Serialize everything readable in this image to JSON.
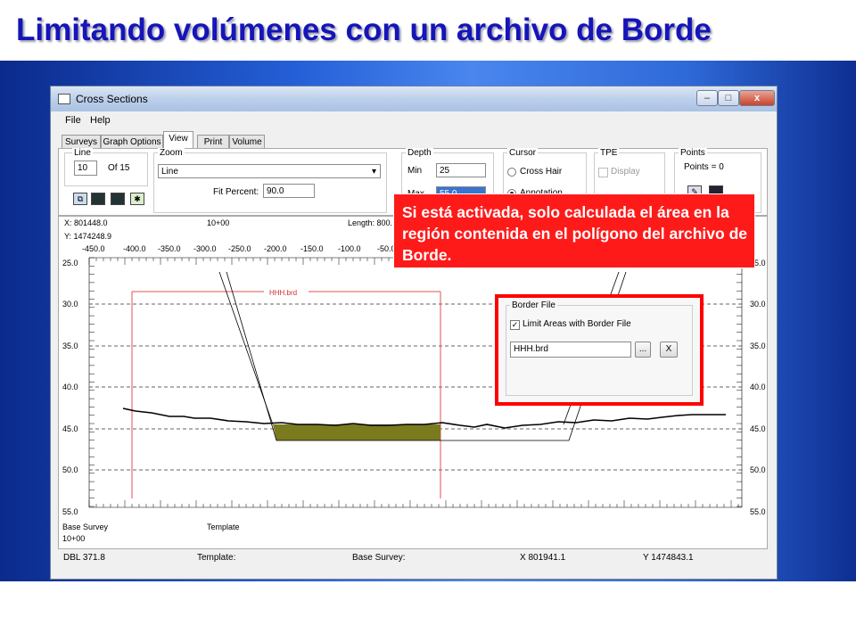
{
  "slide": {
    "title": "Limitando volúmenes con un archivo de Borde",
    "callout_text": "Si está activada, solo calculada el área en la región contenida en el polígono del archivo de Borde."
  },
  "window": {
    "title": "Cross Sections",
    "buttons": {
      "minimize": "–",
      "maximize": "□",
      "close": "x"
    },
    "menu": [
      "File",
      "Help"
    ],
    "tabs": [
      "Surveys",
      "Graph Options",
      "View",
      "Print",
      "Volume"
    ],
    "active_tab": "View"
  },
  "view_panel": {
    "line": {
      "label": "Line",
      "value": "10",
      "of_label": "Of 15"
    },
    "zoom": {
      "label": "Zoom",
      "selected": "Line",
      "fit_percent_label": "Fit Percent:",
      "fit_percent": "90.0"
    },
    "depth": {
      "label": "Depth",
      "min_label": "Min",
      "min": "25",
      "max_label": "Max",
      "max": "55.0"
    },
    "cursor": {
      "label": "Cursor",
      "options": [
        "Cross Hair",
        "Annotation"
      ],
      "selected": "Annotation"
    },
    "tpe": {
      "label": "TPE",
      "display_label": "Display",
      "checked": false
    },
    "points": {
      "label": "Points",
      "count_text": "Points = 0"
    }
  },
  "plot": {
    "x_readout": "X: 801448.0",
    "y_readout": "Y: 1474248.9",
    "station": "10+00",
    "length": "Length: 800.",
    "x_ticks": [
      "-450.0",
      "-400.0",
      "-350.0",
      "-300.0",
      "-250.0",
      "-200.0",
      "-150.0",
      "-100.0",
      "-50.0"
    ],
    "y_ticks": [
      "25.0",
      "30.0",
      "35.0",
      "40.0",
      "45.0",
      "50.0",
      "55.0"
    ],
    "border_label": "HHH.brd",
    "base_survey_label": "Base Survey",
    "base_survey_station": "10+00",
    "template_label": "Template"
  },
  "border_file": {
    "group_label": "Border File",
    "checkbox_label": "Limit Areas with Border File",
    "checked": true,
    "file": "HHH.brd",
    "browse_label": "...",
    "clear_label": "X"
  },
  "status_bar": {
    "dbl": "DBL 371.8",
    "template": "Template:",
    "base_survey": "Base Survey:",
    "x": "X 801941.1",
    "y": "Y 1474843.1"
  },
  "colors": {
    "title": "#1515b8",
    "callout_bg": "#ff1a1a",
    "highlight_border": "#ff0000",
    "fill_area": "#7a7a1e",
    "border_line": "#e05050"
  }
}
